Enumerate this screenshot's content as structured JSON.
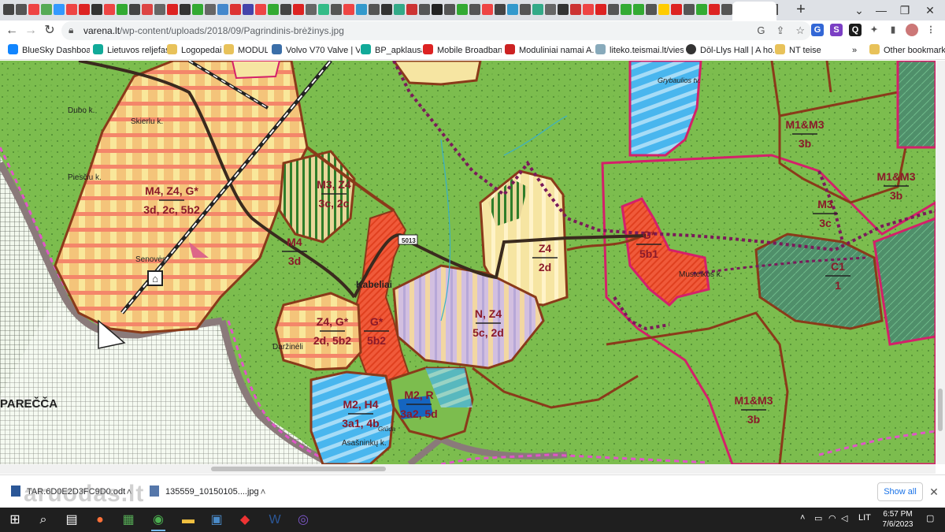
{
  "browser": {
    "tab_icon_colors": [
      "#444",
      "#555",
      "#e44",
      "#5a5",
      "#39f",
      "#e44",
      "#d22",
      "#333",
      "#e44",
      "#3a3",
      "#444",
      "#d44",
      "#666",
      "#d22",
      "#333",
      "#3a3",
      "#666",
      "#48c",
      "#d33",
      "#44a",
      "#e44",
      "#3a3",
      "#444",
      "#d22",
      "#666",
      "#3b8",
      "#555",
      "#e44",
      "#39c",
      "#555",
      "#333",
      "#3a8",
      "#c33",
      "#555",
      "#222",
      "#555",
      "#3a3",
      "#555",
      "#e44",
      "#444",
      "#39c",
      "#555",
      "#3a8",
      "#666",
      "#333",
      "#c33",
      "#e44",
      "#d22",
      "#555",
      "#3a3",
      "#3a3",
      "#555",
      "#fc0",
      "#d22",
      "#555",
      "#3a3",
      "#d22",
      "#555",
      "#e44",
      "#555",
      "#3a3",
      "#555",
      "#c33",
      "#555",
      "#3a3",
      "#555",
      "#e44",
      "#555"
    ],
    "new_tab_label": "+",
    "window_controls": [
      "⌄",
      "—",
      "❐",
      "✕"
    ],
    "url_host": "varena.lt",
    "url_path": "/wp-content/uploads/2018/09/Pagrindinis-brėžinys.jpg",
    "bookmarks": [
      {
        "label": "BlueSky Dashboard",
        "color": "#1185fe",
        "icon": "butterfly-icon"
      },
      {
        "label": "Lietuvos reljefas",
        "color": "#1a9",
        "icon": "relief-icon"
      },
      {
        "label": "Logopedai",
        "color": "#e8c25a",
        "icon": "folder-icon"
      },
      {
        "label": "MODUL",
        "color": "#e8c25a",
        "icon": "folder-icon"
      },
      {
        "label": "Volvo V70 Valve | V...",
        "color": "#3a6ea8",
        "icon": "volvo-icon"
      },
      {
        "label": "BP_apklausa",
        "color": "#1a9",
        "icon": "survey-icon"
      },
      {
        "label": "Mobile Broadband",
        "color": "#d22",
        "icon": "huawei-icon"
      },
      {
        "label": "Moduliniai namai A...",
        "color": "#c22",
        "icon": "ka-icon"
      },
      {
        "label": "liteko.teismai.lt/vies...",
        "color": "#8ab",
        "icon": "court-icon"
      },
      {
        "label": "Dōl-Llys Hall | A ho...",
        "color": "#333",
        "icon": "wordpress-icon"
      },
      {
        "label": "NT teise",
        "color": "#e8c25a",
        "icon": "folder-icon"
      }
    ],
    "bookmarks_more": "»",
    "other_bookmarks": "Other bookmarks"
  },
  "map": {
    "labels": [
      {
        "id": "m4z4g",
        "top": "M4, Z4, G*",
        "bottom": "3d, 2c, 5b2"
      },
      {
        "id": "m3z4",
        "top": "M3, Z4",
        "bottom": "3c, 2c"
      },
      {
        "id": "m4",
        "top": "M4",
        "bottom": "3d"
      },
      {
        "id": "z4",
        "top": "Z4",
        "bottom": "2d"
      },
      {
        "id": "g-musteikos",
        "top": "G*",
        "bottom": "5b1"
      },
      {
        "id": "m1m3-top",
        "top": "M1&M3",
        "bottom": "3b"
      },
      {
        "id": "m1m3-right",
        "top": "M1&M3",
        "bottom": "3b"
      },
      {
        "id": "m3-right",
        "top": "M3",
        "bottom": "3c"
      },
      {
        "id": "c1",
        "top": "C1",
        "bottom": "1"
      },
      {
        "id": "nz4",
        "top": "N, Z4",
        "bottom": "5c, 2d"
      },
      {
        "id": "z4g",
        "top": "Z4, G*",
        "bottom": "2d, 5b2"
      },
      {
        "id": "g-kabeliai",
        "top": "G*",
        "bottom": "5b2"
      },
      {
        "id": "m2h4",
        "top": "M2, H4",
        "bottom": "3a1, 4b"
      },
      {
        "id": "m2r",
        "top": "M2, R",
        "bottom": "3a2, 5d"
      },
      {
        "id": "m1m3-bottom",
        "top": "M1&M3",
        "bottom": "3b"
      }
    ],
    "places": {
      "dubo": "Dubo k.",
      "skierlu": "Skierlu k.",
      "piesciu": "Piesčiu k.",
      "senoves": "Senovės",
      "kabeliai": "Kabeliai",
      "darzineli": "Daržinėli",
      "asasninku": "Asašninkų k.",
      "musteikos": "Musteikos k.",
      "grybaulios": "Grybaulios tv.",
      "parecca": "PAREČČA",
      "road": "5013",
      "gruda": "Grūda"
    }
  },
  "downloads": [
    {
      "name": "TAR.6D0E2D3FC9D0.odt",
      "color": "#2b5797",
      "icon": "document-icon"
    },
    {
      "name": "135559_10150105....jpg",
      "color": "#5577aa",
      "icon": "image-icon"
    }
  ],
  "show_all": "Show all",
  "watermark": "aruodas.lt",
  "taskbar": {
    "apps": [
      {
        "glyph": "⊞",
        "color": "#fff",
        "name": "windows-start-icon"
      },
      {
        "glyph": "⌕",
        "color": "#fff",
        "name": "search-icon"
      },
      {
        "glyph": "▤",
        "color": "#fff",
        "name": "task-view-icon"
      },
      {
        "glyph": "●",
        "color": "#ff7139",
        "name": "firefox-icon"
      },
      {
        "glyph": "▦",
        "color": "#5a5",
        "name": "media-player-icon"
      },
      {
        "glyph": "◉",
        "color": "#4caf50",
        "name": "chrome-icon"
      },
      {
        "glyph": "▬",
        "color": "#f0c040",
        "name": "file-explorer-icon"
      },
      {
        "glyph": "▣",
        "color": "#4a8ac8",
        "name": "remote-desktop-icon"
      },
      {
        "glyph": "◆",
        "color": "#e33",
        "name": "acrobat-icon"
      },
      {
        "glyph": "W",
        "color": "#2b5797",
        "name": "word-icon"
      },
      {
        "glyph": "◎",
        "color": "#7c56c9",
        "name": "viber-icon"
      }
    ],
    "lang": "LIT",
    "time": "6:57 PM",
    "date": "7/6/2023"
  }
}
